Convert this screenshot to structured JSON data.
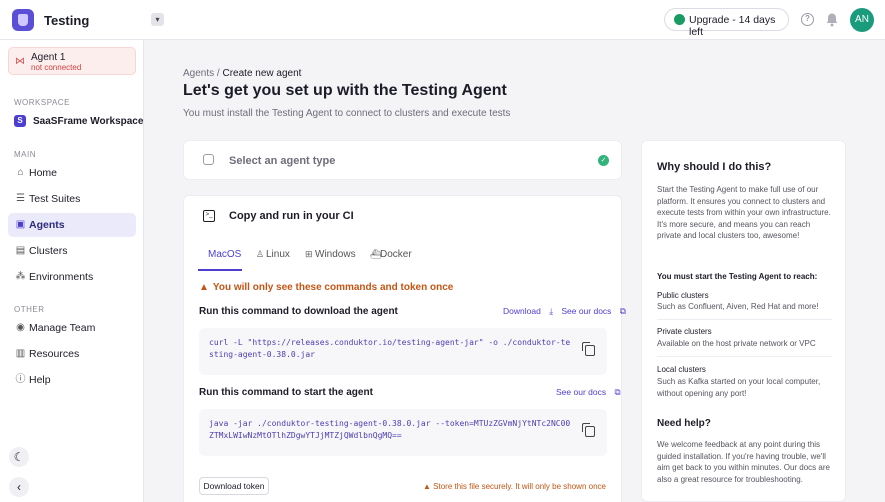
{
  "app": {
    "title": "Testing"
  },
  "header": {
    "upgrade_label": "Upgrade - 14 days left",
    "help_icon": "help-icon",
    "bell_icon": "bell-icon",
    "avatar_initials": "AN"
  },
  "sidebar": {
    "agent": {
      "name": "Agent 1",
      "status": "not connected"
    },
    "workspace_section": "WORKSPACE",
    "workspace_badge": "S",
    "workspace_name": "SaaSFrame Workspace",
    "main_section": "MAIN",
    "main_items": [
      {
        "label": "Home",
        "icon": "home-icon"
      },
      {
        "label": "Test Suites",
        "icon": "list-icon"
      },
      {
        "label": "Agents",
        "icon": "agent-icon"
      },
      {
        "label": "Clusters",
        "icon": "cluster-icon"
      },
      {
        "label": "Environments",
        "icon": "environment-icon"
      }
    ],
    "other_section": "OTHER",
    "other_items": [
      {
        "label": "Manage Team",
        "icon": "team-icon"
      },
      {
        "label": "Resources",
        "icon": "book-icon"
      },
      {
        "label": "Help",
        "icon": "info-icon"
      }
    ]
  },
  "main": {
    "breadcrumb_parent": "Agents",
    "breadcrumb_sep": " / ",
    "breadcrumb_current": "Create new agent",
    "title": "Let's get you set up with the Testing Agent",
    "subtitle": "You must install the Testing Agent to connect to clusters and execute tests",
    "step1_label": "Select an agent type",
    "step2_title": "Copy and run in your CI",
    "tabs": [
      {
        "label": "MacOS",
        "icon": "apple-icon"
      },
      {
        "label": "Linux",
        "icon": "linux-icon"
      },
      {
        "label": "Windows",
        "icon": "windows-icon"
      },
      {
        "label": "Docker",
        "icon": "docker-icon"
      }
    ],
    "warning": "You will only see these commands and token once",
    "download_cmd_title": "Run this command to download the agent",
    "download_link": "Download",
    "docs_link": "See our docs",
    "download_cmd": "curl -L \"https://releases.conduktor.io/testing-agent-jar\" -o ./conduktor-testing-agent-0.38.0.jar",
    "start_cmd_title": "Run this command to start the agent",
    "start_cmd": "java -jar ./conduktor-testing-agent-0.38.0.jar --token=MTUzZGVmNjYtNTc2NC00ZTMxLWIwNzMtOTlhZDgwYTJjMTZjQWdlbnQgMQ==",
    "download_token": "Download token",
    "store_warning": "Store this file securely. It will only be shown once"
  },
  "why": {
    "title": "Why should I do this?",
    "intro": "Start the Testing Agent to make full use of our platform. It ensures you connect to clusters and execute tests from within your own infrastructure. It's more secure, and means you can reach private and local clusters too, awesome!",
    "reach_title": "You must start the Testing Agent to reach:",
    "items": [
      {
        "title": "Public clusters",
        "desc": "Such as Confluent, Aiven, Red Hat and more!"
      },
      {
        "title": "Private clusters",
        "desc": "Available on the host private network or VPC"
      },
      {
        "title": "Local clusters",
        "desc": "Such as Kafka started on your local computer, without opening any port!"
      }
    ],
    "help_title": "Need help?",
    "help_text": "We welcome feedback at any point during this guided installation. If you're having trouble, we'll aim get back to you within minutes. Our docs are also a great resource for troubleshooting."
  },
  "colors": {
    "accent": "#4c3fd0",
    "warning": "#c55514",
    "success": "#1a9b63"
  }
}
